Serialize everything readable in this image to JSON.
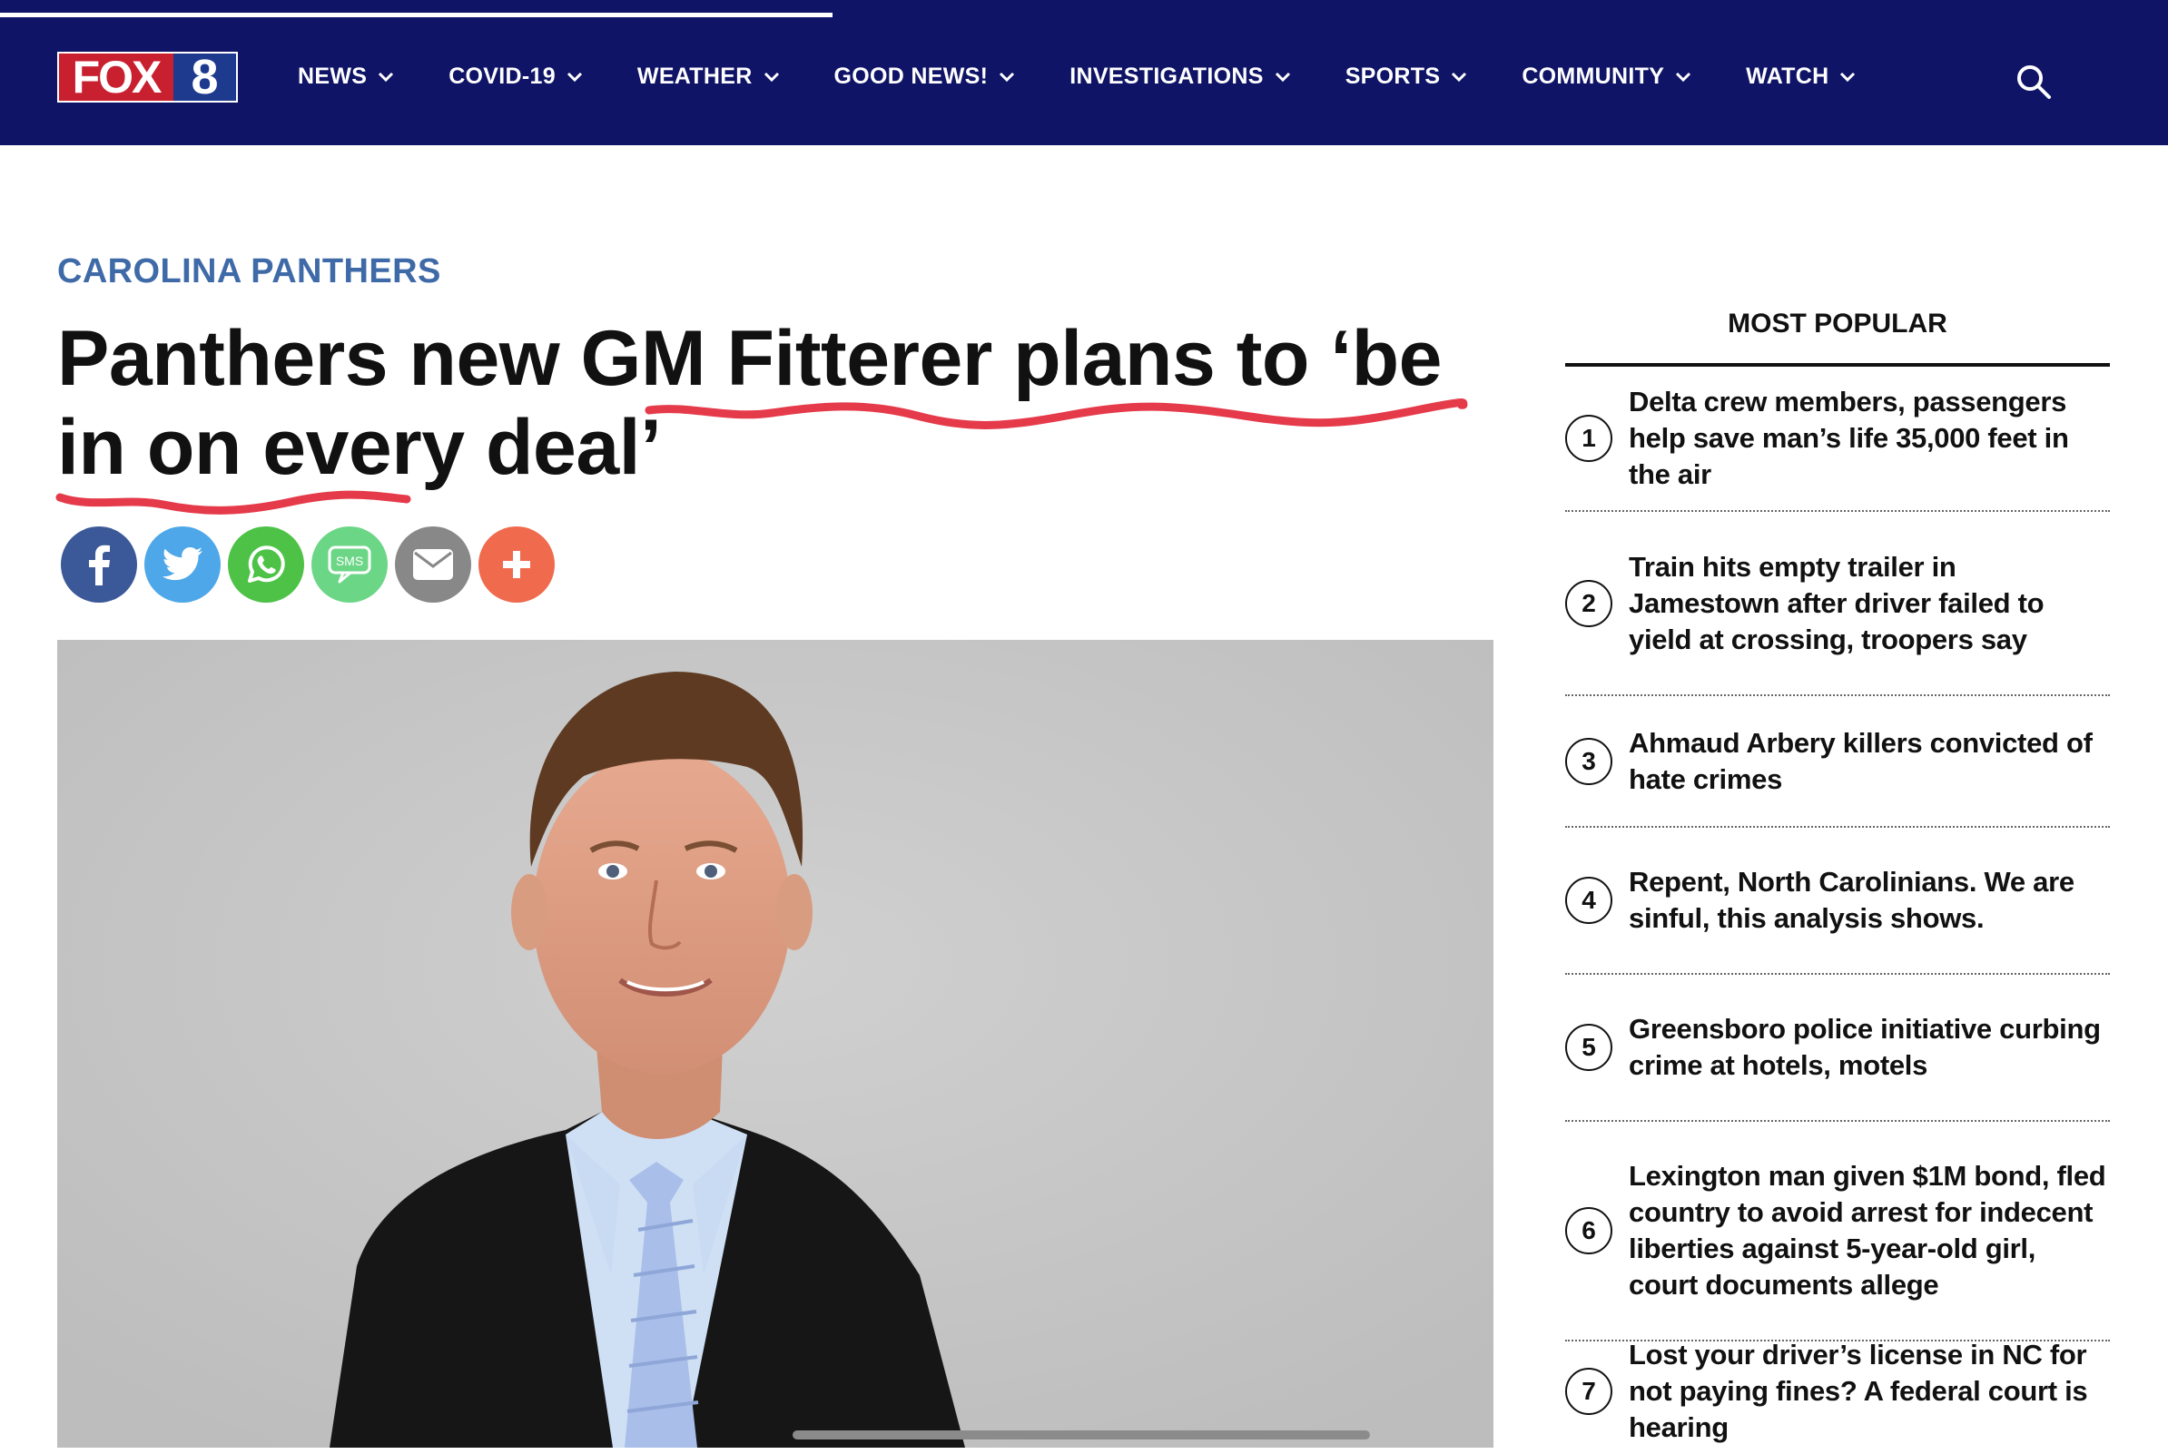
{
  "header": {
    "logo_left": "FOX",
    "logo_right": "8",
    "reading_progress": 0.384,
    "nav": [
      {
        "label": "NEWS"
      },
      {
        "label": "COVID-19"
      },
      {
        "label": "WEATHER"
      },
      {
        "label": "GOOD NEWS!"
      },
      {
        "label": "INVESTIGATIONS"
      },
      {
        "label": "SPORTS"
      },
      {
        "label": "COMMUNITY"
      },
      {
        "label": "WATCH"
      }
    ]
  },
  "article": {
    "kicker": "CAROLINA PANTHERS",
    "headline": "Panthers new GM Fitterer plans to ‘be in on every deal’",
    "share": [
      {
        "name": "facebook",
        "color": "#3b5998"
      },
      {
        "name": "twitter",
        "color": "#4da7e8"
      },
      {
        "name": "whatsapp",
        "color": "#4dc247"
      },
      {
        "name": "sms",
        "color": "#6cd687"
      },
      {
        "name": "email",
        "color": "#888888"
      },
      {
        "name": "more",
        "color": "#f06a4e"
      }
    ],
    "sms_label": "SMS"
  },
  "most_popular": {
    "title": "MOST POPULAR",
    "items": [
      {
        "num": "1",
        "text": "Delta crew members, passengers help save man’s life 35,000 feet in the air"
      },
      {
        "num": "2",
        "text": "Train hits empty trailer in Jamestown after driver failed to yield at crossing, troopers say"
      },
      {
        "num": "3",
        "text": "Ahmaud Arbery killers convicted of hate crimes"
      },
      {
        "num": "4",
        "text": "Repent, North Carolinians. We are sinful, this analysis shows."
      },
      {
        "num": "5",
        "text": "Greensboro police initiative curbing crime at hotels, motels"
      },
      {
        "num": "6",
        "text": "Lexington man given $1M bond, fled country to avoid arrest for indecent liberties against 5-year-old girl, court documents allege"
      },
      {
        "num": "7",
        "text": "Lost your driver’s license in NC for not paying fines? A federal court is hearing"
      }
    ]
  },
  "colors": {
    "header_bg": "#0f1466",
    "kicker": "#3f6aa8",
    "underline": "#e53a4a"
  }
}
